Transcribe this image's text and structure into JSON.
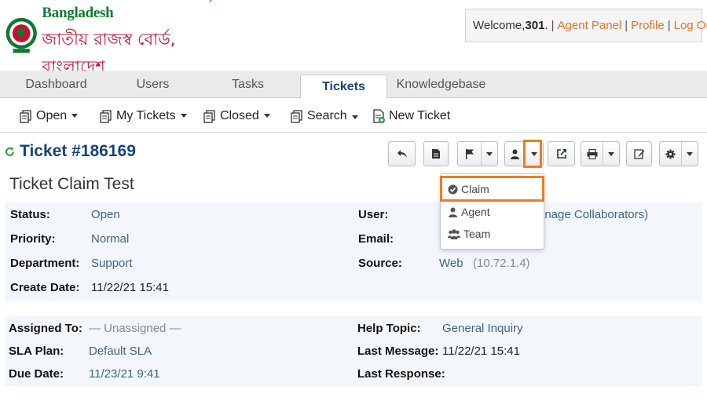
{
  "logo": {
    "name_en": "National Board of Revenue, Bangladesh",
    "name_bn": "জাতীয় রাজস্ব বোর্ড, বাংলাদেশ"
  },
  "welcome": {
    "prefix": "Welcome, ",
    "user": "301",
    "dot": ".",
    "agent_panel": "Agent Panel",
    "profile": "Profile",
    "logout": "Log Out",
    "sep": "|"
  },
  "tabs": [
    {
      "label": "Dashboard"
    },
    {
      "label": "Users"
    },
    {
      "label": "Tasks"
    },
    {
      "label": "Tickets"
    },
    {
      "label": "Knowledgebase"
    }
  ],
  "subnav": {
    "open": "Open",
    "my_tickets": "My Tickets",
    "closed": "Closed",
    "search": "Search",
    "new_ticket": "New Ticket"
  },
  "ticket": {
    "title": "Ticket #186169",
    "subject": "Ticket Claim Test"
  },
  "details": {
    "status_label": "Status:",
    "status_value": "Open",
    "priority_label": "Priority:",
    "priority_value": "Normal",
    "department_label": "Department:",
    "department_value": "Support",
    "create_label": "Create Date:",
    "create_value": "11/22/21 15:41",
    "user_label": "User:",
    "user_value_partial": "anage Collaborators)",
    "email_label": "Email:",
    "source_label": "Source:",
    "source_value": "Web",
    "source_ip": "(10.72.1.4)"
  },
  "assignment": {
    "assigned_label": "Assigned To:",
    "assigned_value": "— Unassigned —",
    "sla_label": "SLA Plan:",
    "sla_value": "Default SLA",
    "due_label": "Due Date:",
    "due_value": "11/23/21 9:41",
    "help_label": "Help Topic:",
    "help_value": "General Inquiry",
    "last_msg_label": "Last Message:",
    "last_msg_value": "11/22/21 15:41",
    "last_resp_label": "Last Response:"
  },
  "assign_menu": {
    "items": [
      {
        "label": "Claim",
        "icon": "shield-check-icon"
      },
      {
        "label": "Agent",
        "icon": "user-icon"
      },
      {
        "label": "Team",
        "icon": "users-icon"
      }
    ]
  },
  "colors": {
    "accent_orange": "#ee7b22",
    "title_blue": "#18427a",
    "link_orange": "#e8702a",
    "value_blue": "#3c6487"
  }
}
